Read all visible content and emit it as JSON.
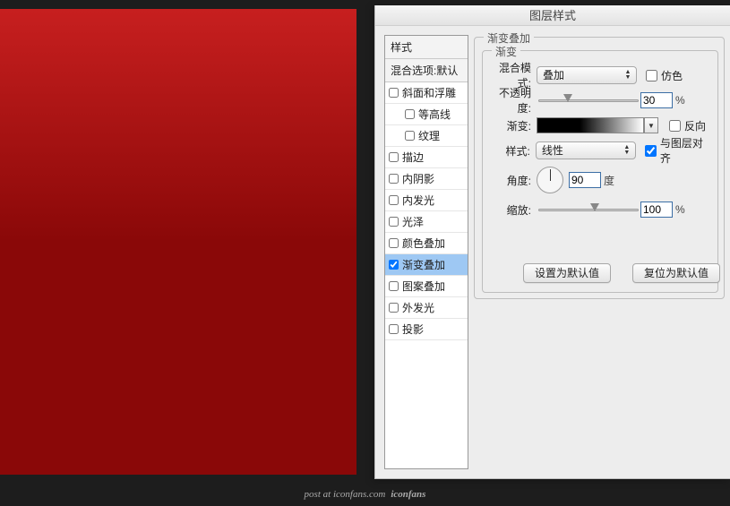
{
  "footer": {
    "prefix": "post at",
    "site": "iconfans.com",
    "brand": "iconfans"
  },
  "dialog_title": "图层样式",
  "left": {
    "header1": "样式",
    "header2": "混合选项:默认",
    "items": [
      {
        "label": "斜面和浮雕",
        "checked": false,
        "indent": false,
        "sel": false
      },
      {
        "label": "等高线",
        "checked": false,
        "indent": true,
        "sel": false
      },
      {
        "label": "纹理",
        "checked": false,
        "indent": true,
        "sel": false
      },
      {
        "label": "描边",
        "checked": false,
        "indent": false,
        "sel": false
      },
      {
        "label": "内阴影",
        "checked": false,
        "indent": false,
        "sel": false
      },
      {
        "label": "内发光",
        "checked": false,
        "indent": false,
        "sel": false
      },
      {
        "label": "光泽",
        "checked": false,
        "indent": false,
        "sel": false
      },
      {
        "label": "颜色叠加",
        "checked": false,
        "indent": false,
        "sel": false
      },
      {
        "label": "渐变叠加",
        "checked": true,
        "indent": false,
        "sel": true
      },
      {
        "label": "图案叠加",
        "checked": false,
        "indent": false,
        "sel": false
      },
      {
        "label": "外发光",
        "checked": false,
        "indent": false,
        "sel": false
      },
      {
        "label": "投影",
        "checked": false,
        "indent": false,
        "sel": false
      }
    ]
  },
  "panel": {
    "outer_legend": "渐变叠加",
    "inner_legend": "渐变",
    "labels": {
      "blend": "混合模式:",
      "opacity": "不透明度:",
      "gradient": "渐变:",
      "style": "样式:",
      "angle": "角度:",
      "scale": "缩放:"
    },
    "blend_value": "叠加",
    "dither_label": "仿色",
    "dither_checked": false,
    "opacity_value": "30",
    "reverse_label": "反向",
    "reverse_checked": false,
    "style_value": "线性",
    "align_label": "与图层对齐",
    "align_checked": true,
    "angle_value": "90",
    "angle_unit": "度",
    "scale_value": "100",
    "pct": "%",
    "btn_default": "设置为默认值",
    "btn_reset": "复位为默认值"
  }
}
